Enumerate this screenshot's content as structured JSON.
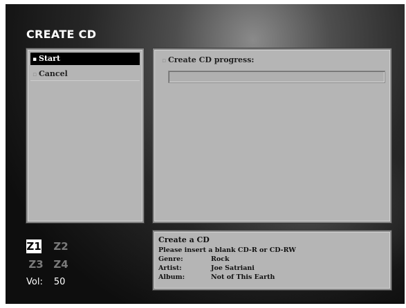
{
  "title": "CREATE CD",
  "menu": {
    "items": [
      {
        "label": "Start",
        "selected": true
      },
      {
        "label": "Cancel",
        "selected": false
      }
    ]
  },
  "progress": {
    "label": "Create CD progress:",
    "value": 0
  },
  "info": {
    "title": "Create a CD",
    "message": "Please insert a blank CD-R or CD-RW",
    "genre_label": "Genre:",
    "genre": "Rock",
    "artist_label": "Artist:",
    "artist": "Joe Satriani",
    "album_label": "Album:",
    "album": "Not of This Earth"
  },
  "zones": [
    {
      "label": "Z1",
      "active": true
    },
    {
      "label": "Z2",
      "active": false
    },
    {
      "label": "Z3",
      "active": false
    },
    {
      "label": "Z4",
      "active": false
    }
  ],
  "volume": {
    "label": "Vol:",
    "value": "50"
  },
  "colors": {
    "panel": "#b5b5b5",
    "selected_bg": "#000000",
    "background": "#1a1a1a"
  }
}
